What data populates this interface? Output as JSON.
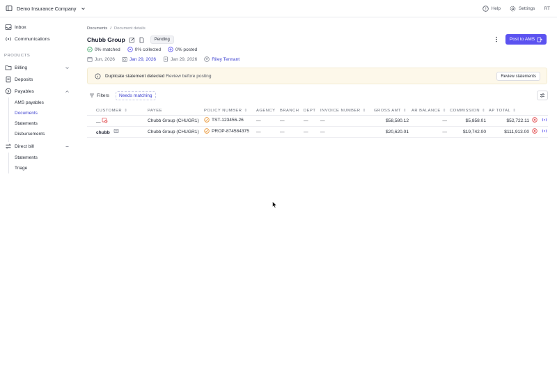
{
  "topbar": {
    "company_name": "Demo Insurance Company",
    "help_label": "Help",
    "settings_label": "Settings",
    "user_initials": "RT",
    "icons": [
      "sidebar-toggle-icon",
      "chevron-down-icon",
      "help-icon",
      "gear-icon"
    ]
  },
  "sidebar": {
    "inbox": "Inbox",
    "communications": "Communications",
    "section_label": "PRODUCTS",
    "billing": "Billing",
    "deposits": "Deposits",
    "payables": "Payables",
    "payables_items": [
      "AMS payables",
      "Documents",
      "Statements",
      "Disbursements"
    ],
    "direct_bill": "Direct bill",
    "direct_bill_items": [
      "Statements",
      "Triage"
    ],
    "active_item": "Documents"
  },
  "breadcrumb": {
    "root": "Documents",
    "sep": "/",
    "current": "Document details"
  },
  "document": {
    "title": "Chubb Group",
    "status": "Pending",
    "matched": "0% matched",
    "collected": "0% collected",
    "posted": "0% posted",
    "date_1": "Jun, 2026",
    "date_2": "Jan 29, 2026",
    "date_3": "Jan 29, 2026",
    "assignee": "Riley Tennant",
    "post_button": "Post to AMS"
  },
  "alert": {
    "title": "Duplicate statement detected",
    "subtitle": "Review before posting",
    "button": "Review statements"
  },
  "filters": {
    "label": "Filters",
    "chip": "Needs matching"
  },
  "table": {
    "headers": [
      "CUSTOMER",
      "PAYEE",
      "POLICY NUMBER",
      "AGENCY",
      "BRANCH",
      "DEPT",
      "INVOICE NUMBER",
      "GROSS AMT",
      "AR BALANCE",
      "COMMISSION",
      "AP TOTAL"
    ],
    "rows": [
      {
        "customer": "—",
        "payee": "Chubb Group (CHUGR1)",
        "policy": "TST-123456-26",
        "agency": "—",
        "branch": "—",
        "dept": "—",
        "invoice": "—",
        "gross": "$58,580.12",
        "ar": "—",
        "commission": "$5,858.01",
        "ap_total": "$52,722.11"
      },
      {
        "customer": "chubb",
        "payee": "Chubb Group (CHUGR1)",
        "policy": "PROP-874584375",
        "agency": "—",
        "branch": "—",
        "dept": "—",
        "invoice": "—",
        "gross": "$20,620.01",
        "ar": "—",
        "commission": "$19,742.00",
        "ap_total": "$111,913.00"
      }
    ]
  },
  "colors": {
    "accent": "#5b52f0",
    "link": "#3b3fcf",
    "alert_bg": "#fdf8ea",
    "error": "#e0464a",
    "warning": "#e8912d"
  }
}
